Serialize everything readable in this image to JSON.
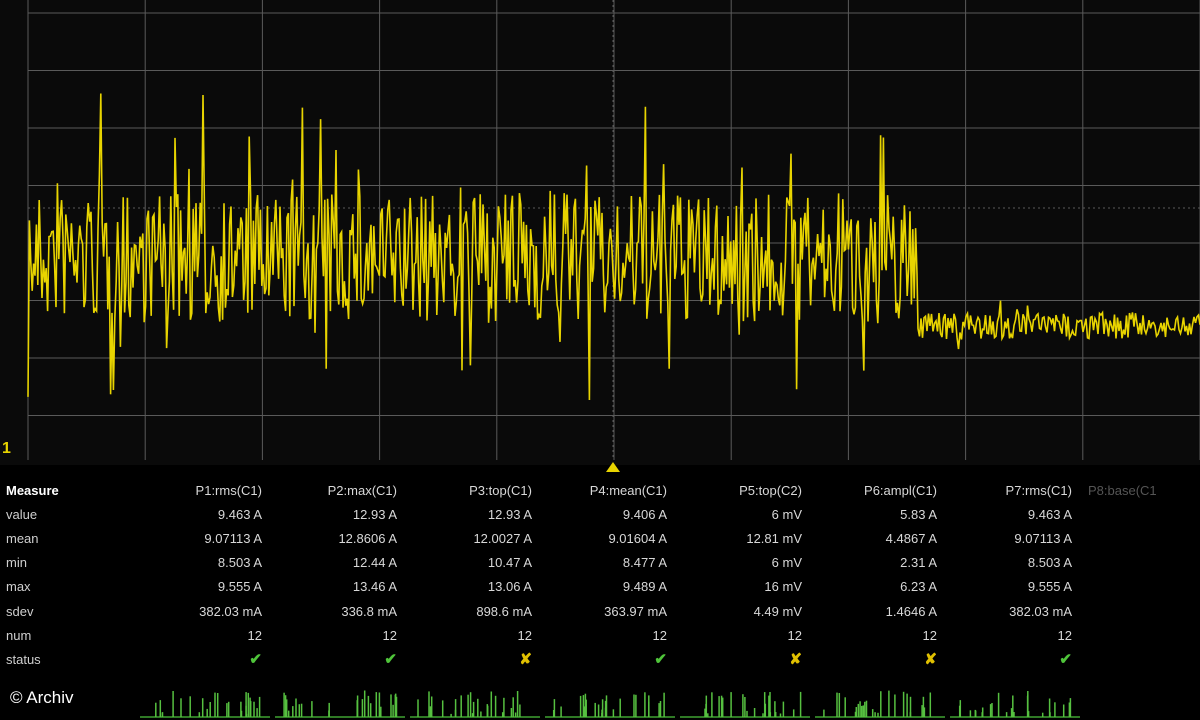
{
  "colors": {
    "trace": "#e8d400",
    "grid": "#5a5a5a",
    "ok": "#4fc43a",
    "fail": "#e0c000"
  },
  "channel_marker": "1",
  "measure": {
    "header": "Measure",
    "columns": [
      "P1:rms(C1)",
      "P2:max(C1)",
      "P3:top(C1)",
      "P4:mean(C1)",
      "P5:top(C2)",
      "P6:ampl(C1)",
      "P7:rms(C1)",
      "P8:base(C1"
    ],
    "rows": [
      {
        "label": "value",
        "cells": [
          "9.463 A",
          "12.93 A",
          "12.93 A",
          "9.406 A",
          "6 mV",
          "5.83 A",
          "9.463 A"
        ]
      },
      {
        "label": "mean",
        "cells": [
          "9.07113 A",
          "12.8606 A",
          "12.0027 A",
          "9.01604 A",
          "12.81 mV",
          "4.4867 A",
          "9.07113 A"
        ]
      },
      {
        "label": "min",
        "cells": [
          "8.503 A",
          "12.44 A",
          "10.47 A",
          "8.477 A",
          "6 mV",
          "2.31 A",
          "8.503 A"
        ]
      },
      {
        "label": "max",
        "cells": [
          "9.555 A",
          "13.46 A",
          "13.06 A",
          "9.489 A",
          "16 mV",
          "6.23 A",
          "9.555 A"
        ]
      },
      {
        "label": "sdev",
        "cells": [
          "382.03 mA",
          "336.8 mA",
          "898.6 mA",
          "363.97 mA",
          "4.49 mV",
          "1.4646 A",
          "382.03 mA"
        ]
      },
      {
        "label": "num",
        "cells": [
          "12",
          "12",
          "12",
          "12",
          "12",
          "12",
          "12"
        ]
      }
    ],
    "status_label": "status",
    "status": [
      "ok",
      "ok",
      "fail",
      "ok",
      "fail",
      "fail",
      "ok"
    ],
    "status_icons": {
      "ok": "✔",
      "fail": "✘"
    }
  },
  "copyright": "© Archiv"
}
